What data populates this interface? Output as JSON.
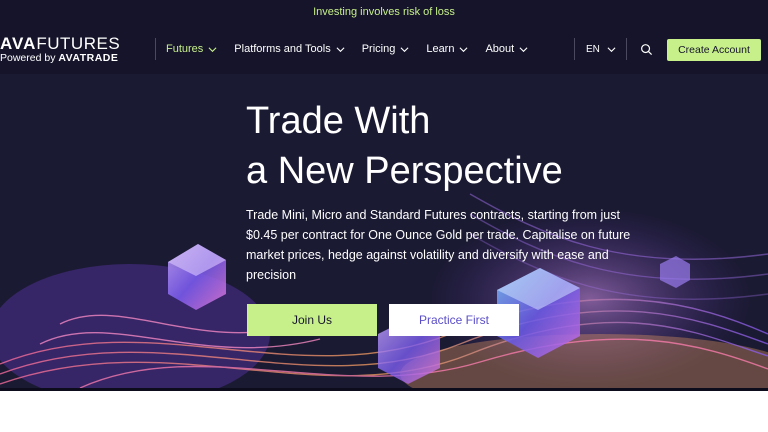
{
  "banner": {
    "text": "Investing involves risk of loss"
  },
  "logo": {
    "ava": "AVA",
    "futures": "FUTURES",
    "powered": "Powered by ",
    "brand": "AVATRADE"
  },
  "nav": {
    "items": [
      {
        "label": "Futures",
        "active": true
      },
      {
        "label": "Platforms and Tools",
        "active": false
      },
      {
        "label": "Pricing",
        "active": false
      },
      {
        "label": "Learn",
        "active": false
      },
      {
        "label": "About",
        "active": false
      }
    ],
    "lang": "EN",
    "cta": "Create Account"
  },
  "hero": {
    "title_line1": "Trade With",
    "title_line2": "a New Perspective",
    "description": "Trade Mini, Micro and Standard Futures contracts, starting from just $0.45 per contract for One Ounce Gold per trade. Capitalise on future market prices, hedge against volatility and diversify with ease and precision",
    "join_label": "Join Us",
    "practice_label": "Practice First"
  },
  "colors": {
    "navy": "#15142a",
    "accent": "#c7f08a",
    "purple": "#5a4ec8"
  },
  "icons": {
    "search": "search-icon",
    "chevron": "chevron-down-icon"
  }
}
